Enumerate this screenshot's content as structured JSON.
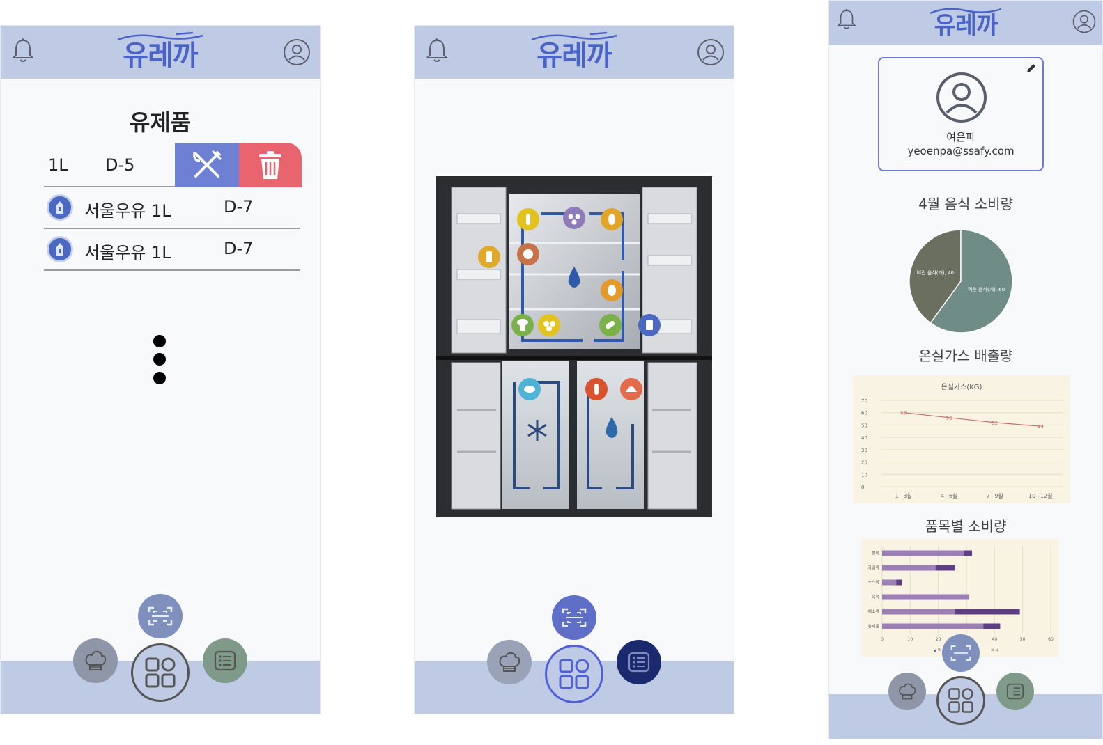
{
  "app": {
    "logo_text": "유레까",
    "colors": {
      "header": "#bfcbe4",
      "accent": "#4a63c9",
      "eat": "#6d80d4",
      "delete": "#e8646e",
      "chef_fab": "#8f96a8",
      "list_fab": "#7f9a88",
      "list_fab_active": "#1b2a6e",
      "scan_fab": "#7f90bd",
      "scan_fab_active": "#5f6fc8"
    }
  },
  "screen1": {
    "category_title": "유제품",
    "swipe_row": {
      "qty": "1L",
      "dday": "D-5",
      "eat_icon": "fork-knife-icon",
      "delete_icon": "trash-icon"
    },
    "items": [
      {
        "name": "서울우유 1L",
        "dday": "D-7",
        "icon": "milk-carton-icon"
      },
      {
        "name": "서울우유 1L",
        "dday": "D-7",
        "icon": "milk-carton-icon"
      }
    ]
  },
  "screen2": {
    "fridge_image": "refrigerator-open-view",
    "food_icons": [
      "wheat-icon",
      "beans-icon",
      "peanut-icon",
      "bottle-icon",
      "coconut-icon",
      "egg-icon",
      "mushroom-icon",
      "potato-icon",
      "cucumber-icon",
      "milk-carton-icon",
      "fish-icon",
      "lobster-icon",
      "shell-icon",
      "snowflake-icon",
      "water-drop-icon"
    ]
  },
  "screen3": {
    "profile": {
      "name": "여은파",
      "email": "yeoenpa@ssafy.com"
    },
    "section_titles": {
      "pie": "4월 음식 소비량",
      "line": "온실가스 배출량",
      "bar": "품목별 소비량"
    },
    "chart_data": [
      {
        "type": "pie",
        "slices": [
          {
            "label": "버린 음식(개), 40",
            "value": 40,
            "color": "#6b6f5f"
          },
          {
            "label": "먹은 음식(개), 60",
            "value": 60,
            "color": "#6f8d86"
          }
        ]
      },
      {
        "type": "line",
        "title": "온실가스(KG)",
        "categories": [
          "1~3월",
          "4~6월",
          "7~9월",
          "10~12월"
        ],
        "series": [
          {
            "values": [
              60,
              56,
              52,
              49
            ],
            "color": "#c96b6b"
          }
        ],
        "ylim": [
          0,
          70
        ],
        "yticks": [
          "0",
          "10",
          "20",
          "30",
          "40",
          "50",
          "60",
          "70"
        ],
        "grid": true
      },
      {
        "type": "bar",
        "orientation": "horizontal",
        "stacked": true,
        "categories": [
          "빵류",
          "과일류",
          "소스류",
          "육류",
          "채소류",
          "유제품"
        ],
        "series": [
          {
            "values": [
              29,
              19,
              5,
              31,
              26,
              36
            ],
            "color": "#9b7fb5"
          },
          {
            "values": [
              3,
              7,
              2,
              0,
              23,
              6
            ],
            "color": "#5e3f84"
          }
        ],
        "xlim": [
          0,
          60
        ],
        "xticks": [
          "0",
          "10",
          "20",
          "30",
          "40",
          "50",
          "60"
        ],
        "legend_partial": [
          "▪ 먹",
          "음식"
        ],
        "grid": true
      }
    ]
  }
}
